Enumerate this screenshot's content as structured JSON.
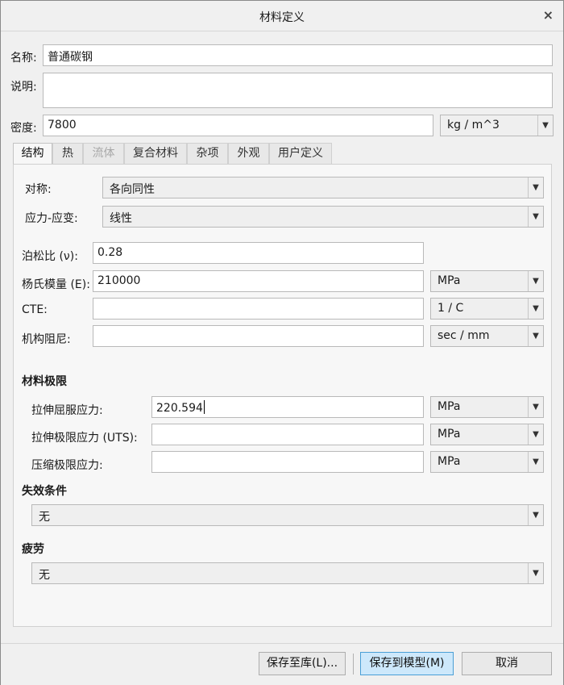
{
  "window": {
    "title": "材料定义",
    "close_icon": "×"
  },
  "name": {
    "label": "名称:",
    "value": "普通碳钢"
  },
  "description": {
    "label": "说明:",
    "value": ""
  },
  "density": {
    "label": "密度:",
    "value": "7800",
    "unit": "kg / m^3"
  },
  "tabs": [
    {
      "label": "结构",
      "active": true,
      "disabled": false
    },
    {
      "label": "热",
      "active": false,
      "disabled": false
    },
    {
      "label": "流体",
      "active": false,
      "disabled": true
    },
    {
      "label": "复合材料",
      "active": false,
      "disabled": false
    },
    {
      "label": "杂项",
      "active": false,
      "disabled": false
    },
    {
      "label": "外观",
      "active": false,
      "disabled": false
    },
    {
      "label": "用户定义",
      "active": false,
      "disabled": false
    }
  ],
  "structural": {
    "symmetry": {
      "label": "对称:",
      "value": "各向同性"
    },
    "stress_strain": {
      "label": "应力-应变:",
      "value": "线性"
    },
    "poisson": {
      "label": "泊松比 (ν):",
      "value": "0.28"
    },
    "young": {
      "label": "杨氏模量 (E):",
      "value": "210000",
      "unit": "MPa"
    },
    "cte": {
      "label": "CTE:",
      "value": "",
      "unit": "1 / C"
    },
    "damping": {
      "label": "机构阻尼:",
      "value": "",
      "unit": "sec / mm"
    }
  },
  "material_limits": {
    "title": "材料极限",
    "tensile_yield": {
      "label": "拉伸屈服应力:",
      "value": "220.594",
      "unit": "MPa"
    },
    "tensile_uts": {
      "label": "拉伸极限应力 (UTS):",
      "value": "",
      "unit": "MPa"
    },
    "compressive": {
      "label": "压缩极限应力:",
      "value": "",
      "unit": "MPa"
    }
  },
  "failure": {
    "title": "失效条件",
    "value": "无"
  },
  "fatigue": {
    "title": "疲劳",
    "value": "无"
  },
  "buttons": {
    "save_library": "保存至库(L)...",
    "save_model": "保存到模型(M)",
    "cancel": "取消"
  }
}
